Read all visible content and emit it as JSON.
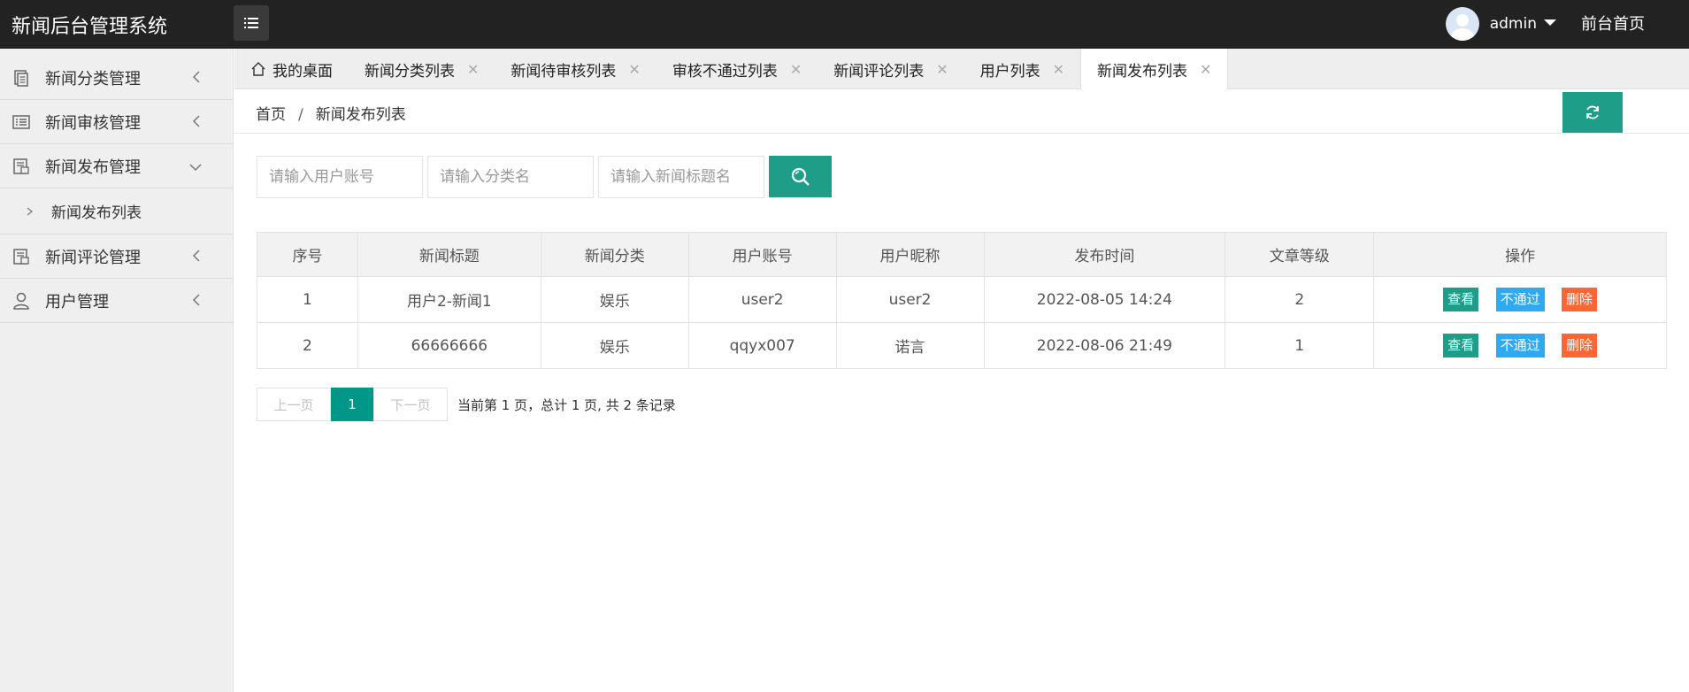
{
  "header": {
    "app_title": "新闻后台管理系统",
    "username": "admin",
    "front_link": "前台首页"
  },
  "sidebar": {
    "items": [
      {
        "label": "新闻分类管理",
        "icon": "document-icon",
        "expanded": false
      },
      {
        "label": "新闻审核管理",
        "icon": "list-icon",
        "expanded": false
      },
      {
        "label": "新闻发布管理",
        "icon": "publish-icon",
        "expanded": true,
        "children": [
          {
            "label": "新闻发布列表"
          }
        ]
      },
      {
        "label": "新闻评论管理",
        "icon": "comment-icon",
        "expanded": false
      },
      {
        "label": "用户管理",
        "icon": "user-icon",
        "expanded": false
      }
    ]
  },
  "tabs": [
    {
      "label": "我的桌面",
      "closable": false
    },
    {
      "label": "新闻分类列表",
      "closable": true
    },
    {
      "label": "新闻待审核列表",
      "closable": true
    },
    {
      "label": "审核不通过列表",
      "closable": true
    },
    {
      "label": "新闻评论列表",
      "closable": true
    },
    {
      "label": "用户列表",
      "closable": true
    },
    {
      "label": "新闻发布列表",
      "closable": true,
      "active": true
    }
  ],
  "breadcrumb": {
    "home": "首页",
    "separator": "/",
    "current": "新闻发布列表"
  },
  "search": {
    "account_placeholder": "请输入用户账号",
    "category_placeholder": "请输入分类名",
    "title_placeholder": "请输入新闻标题名"
  },
  "table": {
    "columns": [
      "序号",
      "新闻标题",
      "新闻分类",
      "用户账号",
      "用户昵称",
      "发布时间",
      "文章等级",
      "操作"
    ],
    "rows": [
      {
        "no": "1",
        "title": "用户2-新闻1",
        "category": "娱乐",
        "account": "user2",
        "nickname": "user2",
        "time": "2022-08-05 14:24",
        "level": "2"
      },
      {
        "no": "2",
        "title": "66666666",
        "category": "娱乐",
        "account": "qqyx007",
        "nickname": "诺言",
        "time": "2022-08-06 21:49",
        "level": "1"
      }
    ],
    "actions": {
      "view": "查看",
      "reject": "不通过",
      "delete": "删除"
    }
  },
  "pagination": {
    "prev": "上一页",
    "current": "1",
    "next": "下一页",
    "info": "当前第 1 页，总计 1 页, 共 2 条记录"
  },
  "colors": {
    "header_bg": "#222222",
    "primary": "#1e9e88",
    "info": "#2fa9ef",
    "danger": "#ff6633"
  }
}
